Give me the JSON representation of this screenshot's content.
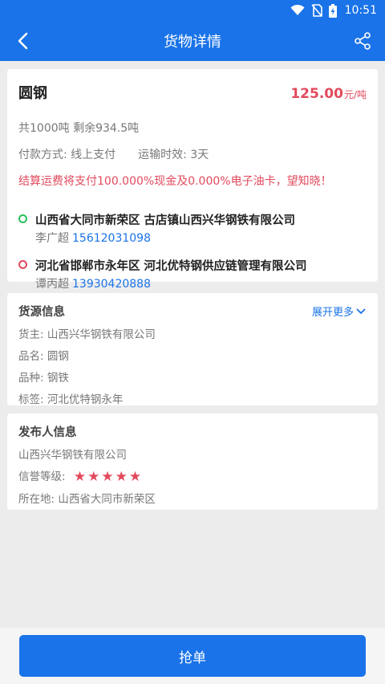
{
  "status_bar": {
    "time": "10:51",
    "icons": [
      "wifi-icon",
      "no-sim-icon",
      "battery-charging-icon"
    ]
  },
  "navbar": {
    "title": "货物详情",
    "back_icon": "back-arrow-icon",
    "share_icon": "share-icon"
  },
  "goods": {
    "name": "圆钢",
    "price": "125.00",
    "price_unit": "元/吨",
    "quantity": "共1000吨 剩余934.5吨",
    "payment": "付款方式: 线上支付",
    "transport_time": "运输时效: 3天",
    "settlement_notice": "结算运费将支付100.000%现金及0.000%电子油卡，望知晓！"
  },
  "route": {
    "origin": {
      "address": "山西省大同市新荣区 古店镇山西兴华钢铁有限公司",
      "contact": "李广超",
      "phone": "15612031098"
    },
    "destination": {
      "address": "河北省邯郸市永年区 河北优特钢供应链管理有限公司",
      "contact": "谭丙超",
      "phone": "13930420888"
    }
  },
  "source_info": {
    "title": "货源信息",
    "expand_label": "展开更多",
    "owner": "货主: 山西兴华钢铁有限公司",
    "product": "品名: 圆钢",
    "category": "品种: 钢铁",
    "tags": "标签: 河北优特钢永年"
  },
  "publisher": {
    "title": "发布人信息",
    "company": "山西兴华钢铁有限公司",
    "credit_label": "信誉等级:",
    "credit_stars": 5,
    "location": "所在地: 山西省大同市新荣区"
  },
  "actions": {
    "grab_label": "抢单"
  },
  "colors": {
    "primary": "#1a73e8",
    "accent_red": "#e24a5c",
    "origin_green": "#2bbf5a"
  }
}
